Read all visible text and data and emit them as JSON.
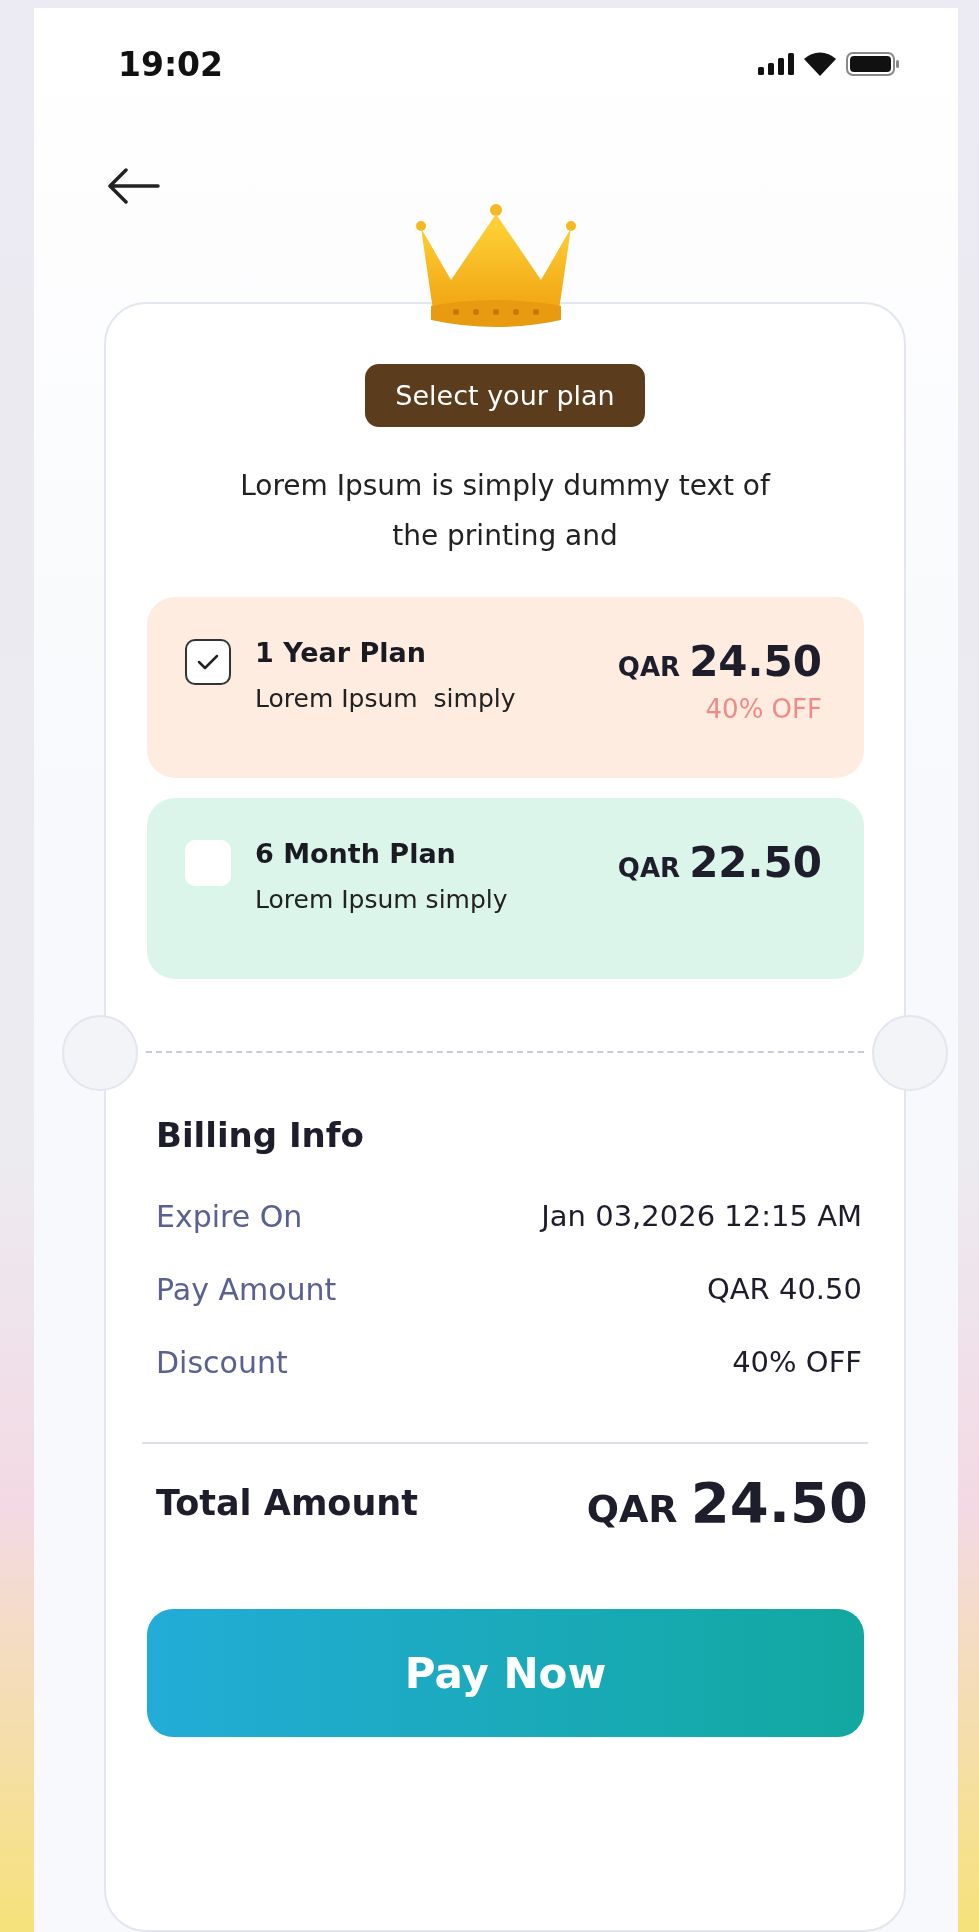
{
  "status_bar": {
    "time": "19:02"
  },
  "header": {
    "badge": "Select your plan",
    "description": "Lorem Ipsum is simply dummy text of the printing and"
  },
  "plans": [
    {
      "title": "1 Year Plan",
      "subtitle": "Lorem Ipsum  simply",
      "currency": "QAR",
      "price": "24.50",
      "discount": "40% OFF",
      "selected": true,
      "color": "#fdecdf"
    },
    {
      "title": "6 Month Plan",
      "subtitle": "Lorem Ipsum simply",
      "currency": "QAR",
      "price": "22.50",
      "selected": false,
      "color": "#dcf5ea"
    }
  ],
  "billing": {
    "title": "Billing Info",
    "rows": [
      {
        "label": "Expire On",
        "value": "Jan 03,2026 12:15 AM"
      },
      {
        "label": "Pay Amount",
        "value": "QAR 40.50"
      },
      {
        "label": "Discount",
        "value": "40% OFF"
      }
    ]
  },
  "total": {
    "label": "Total Amount",
    "currency": "QAR",
    "amount": "24.50"
  },
  "button": "Pay Now"
}
